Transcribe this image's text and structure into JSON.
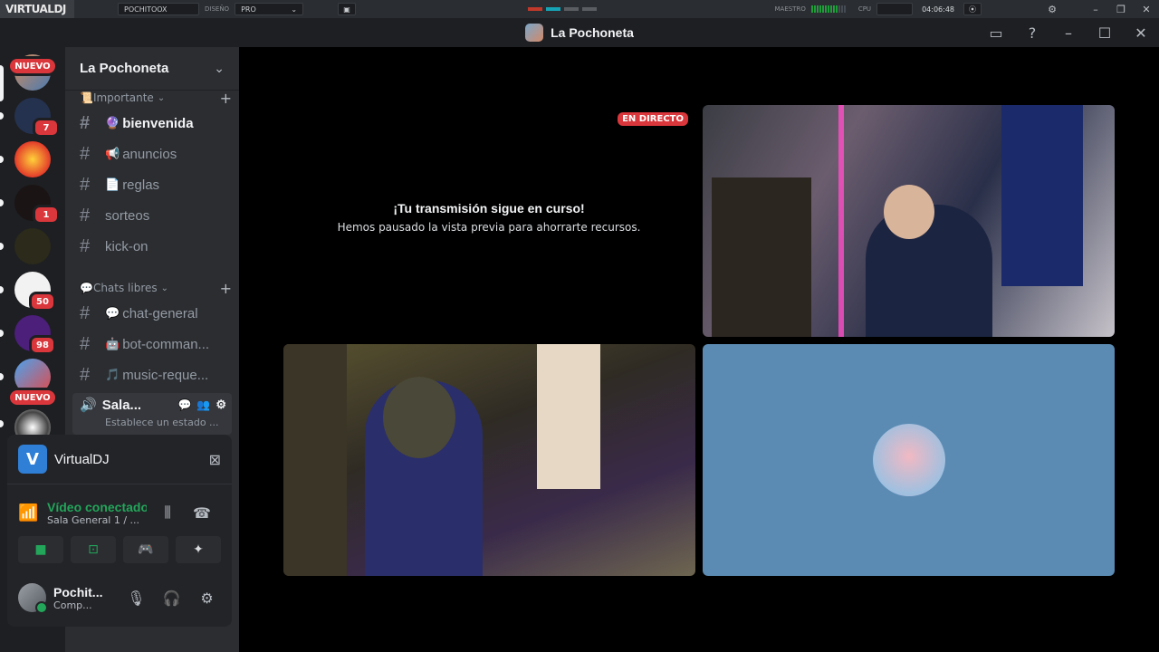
{
  "vdj": {
    "logo": "VIRTUALDJ",
    "user": "POCHITOOX",
    "design_label": "DISEÑO",
    "design_value": "PRO",
    "master_label": "MAESTRO",
    "cpu_label": "CPU",
    "time": "04:06:48"
  },
  "window": {
    "title": "La Pochoneta"
  },
  "servers": {
    "nuevo_label": "NUEVO",
    "badges": [
      "7",
      "1",
      "50",
      "98"
    ]
  },
  "guild": {
    "name": "La Pochoneta",
    "categories": [
      {
        "label": "📜Importante",
        "channels": [
          {
            "emoji": "🔮",
            "name": "bienvenida",
            "active": true
          },
          {
            "emoji": "📢",
            "name": "anuncios"
          },
          {
            "emoji": "📄",
            "name": "reglas"
          },
          {
            "emoji": "",
            "name": "sorteos"
          },
          {
            "emoji": "",
            "name": "kick-on"
          }
        ]
      },
      {
        "label": "💬Chats libres",
        "channels": [
          {
            "emoji": "💬",
            "name": "chat-general"
          },
          {
            "emoji": "🤖",
            "name": "bot-comman..."
          },
          {
            "emoji": "🎵",
            "name": "music-reque..."
          }
        ]
      }
    ],
    "voice_channel": {
      "name": "Sala...",
      "status": "Establece un estado ..."
    }
  },
  "user_area": {
    "stream_app": "VirtualDJ",
    "rtc_status": "Vídeo conectado",
    "rtc_channel": "Sala General 1 / ...",
    "user_name": "Pochit...",
    "user_sub": "Comp..."
  },
  "stage": {
    "live_label": "EN DIRECTO",
    "preview_title": "¡Tu transmisión sigue en curso!",
    "preview_sub": "Hemos pausado la vista previa para ahorrarte recursos."
  },
  "colors": {
    "live_red": "#da373c",
    "connected_green": "#23a55a",
    "tile_blue": "#5b8bb3"
  }
}
